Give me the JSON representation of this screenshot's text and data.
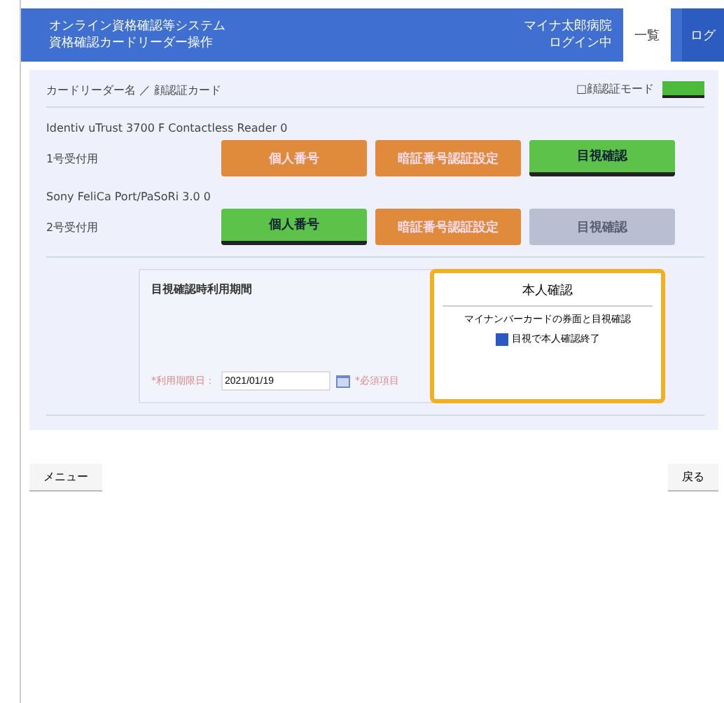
{
  "header": {
    "title_lines": [
      "オンライン資格確認等システム",
      "資格確認カードリーダー操作"
    ],
    "facility": "マイナ太郎病院",
    "user": "ログイン中",
    "list_button": "一覧",
    "edge_button": "ログ"
  },
  "breadcrumb": {
    "items": [
      "カードリーダー名",
      "顔認証カード"
    ],
    "separator": "／"
  },
  "mode": {
    "label": "□顔認証モード",
    "on": true
  },
  "readers": [
    {
      "device": "Identiv uTrust 3700 F Contactless Reader 0",
      "label": "1号受付用",
      "buttons": [
        {
          "label": "個人番号",
          "selected": false,
          "disabled": false
        },
        {
          "label": "暗証番号認証設定",
          "selected": false,
          "disabled": false
        },
        {
          "label": "目視確認",
          "selected": true,
          "disabled": false
        }
      ]
    },
    {
      "device": "Sony FeliCa Port/PaSoRi 3.0 0",
      "label": "2号受付用",
      "buttons": [
        {
          "label": "個人番号",
          "selected": true,
          "disabled": false
        },
        {
          "label": "暗証番号認証設定",
          "selected": false,
          "disabled": false
        },
        {
          "label": "目視確認",
          "selected": false,
          "disabled": true
        }
      ]
    }
  ],
  "period": {
    "title": "目視確認時利用期間",
    "date_label": "*利用期限日：",
    "date_value": "2021/01/19",
    "note": "*必須項目"
  },
  "popup": {
    "title": "本人確認",
    "message": "マイナンバーカードの券面と目視確認",
    "checkbox": {
      "label": "目視で本人確認終了",
      "checked": true
    }
  },
  "footer": {
    "left_button": "メニュー",
    "right_button": "戻る"
  }
}
